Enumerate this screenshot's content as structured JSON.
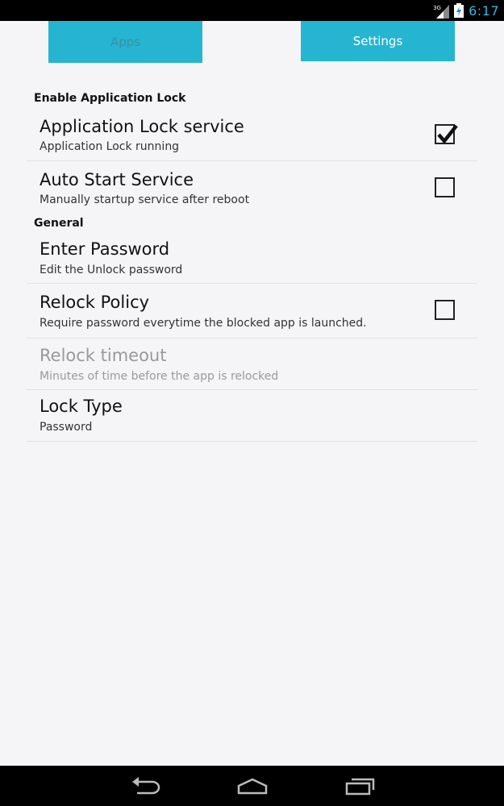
{
  "status_bar": {
    "network_label": "3G",
    "time": "6:17",
    "accent": "#33b5e5",
    "icons": [
      "signal-icon",
      "battery-charging-icon"
    ]
  },
  "tabs": [
    {
      "label": "Apps",
      "selected": false
    },
    {
      "label": "Settings",
      "selected": true
    }
  ],
  "sections": {
    "enable": {
      "header": "Enable Application Lock"
    },
    "general": {
      "header": "General"
    }
  },
  "prefs": {
    "lock_service": {
      "title": "Application Lock service",
      "summary": "Application Lock running",
      "checked": true
    },
    "auto_start": {
      "title": "Auto Start Service",
      "summary": "Manually startup service after reboot",
      "checked": false
    },
    "enter_password": {
      "title": "Enter Password",
      "summary": "Edit the Unlock password"
    },
    "relock_policy": {
      "title": "Relock Policy",
      "summary": "Require password everytime the blocked app is launched.",
      "checked": false
    },
    "relock_timeout": {
      "title": "Relock timeout",
      "summary": "Minutes of time before the app is relocked",
      "enabled": false
    },
    "lock_type": {
      "title": "Lock Type",
      "summary": "Password"
    }
  },
  "colors": {
    "tab_background": "#25b5d1",
    "background": "#f5f5f7"
  },
  "nav_bar": {
    "icons": [
      "back-icon",
      "home-icon",
      "recent-apps-icon"
    ]
  }
}
